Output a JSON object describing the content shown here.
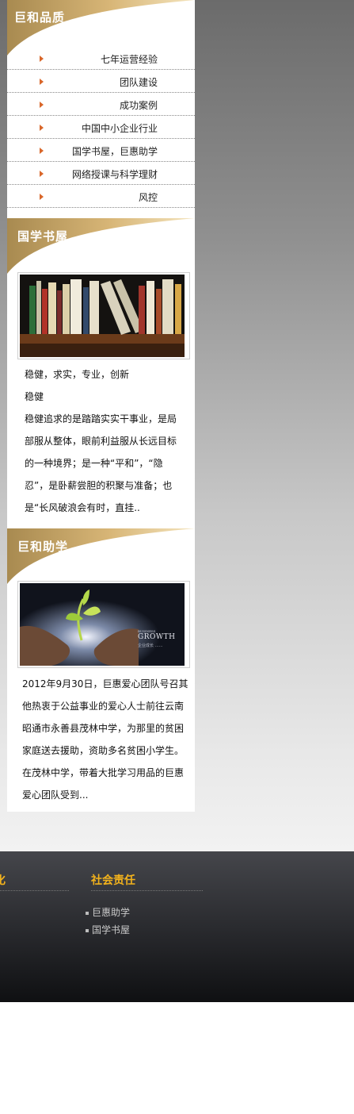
{
  "quality": {
    "title": "巨和品质",
    "items": [
      {
        "label": "七年运营经验"
      },
      {
        "label": "团队建设"
      },
      {
        "label": "成功案例"
      },
      {
        "label": "中国中小企业行业"
      },
      {
        "label": "国学书屋，巨惠助学"
      },
      {
        "label": "网络授课与科学理财"
      },
      {
        "label": "风控"
      }
    ]
  },
  "bookhouse": {
    "title": "国学书屋",
    "lines": [
      "稳健，求实，专业，创新",
      "稳健",
      "稳健追求的是踏踏实实干事业，是局",
      "部服从整体，眼前利益服从长远目标",
      "的一种境界；是一种“平和”，“隐",
      "忍”，是卧薪尝胆的积聚与准备；也",
      "是“长风破浪会有时，直挂.."
    ]
  },
  "aid": {
    "title": "巨和助学",
    "image_text": {
      "small": "BUSINESS",
      "big": "GROWTH",
      "sub": "企业成长 ……"
    },
    "lines": [
      "2012年9月30日，巨惠爱心团队号召其",
      "他热衷于公益事业的爱心人士前往云南",
      "昭通市永善县茂林中学，为那里的贫困",
      "家庭送去援助，资助多名贫困小学生。",
      "在茂林中学，带着大批学习用品的巨惠",
      "爱心团队受到..."
    ]
  },
  "footer": {
    "clipped_title": "化",
    "title": "社会责任",
    "links": [
      "巨惠助学",
      "国学书屋"
    ]
  },
  "colors": {
    "accent_gold": "#c8a55b",
    "footer_title": "#f2b21c",
    "arrow": "#d9672a"
  }
}
